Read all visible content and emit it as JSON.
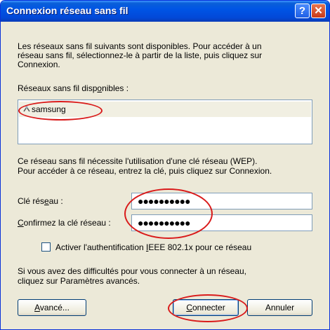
{
  "window": {
    "title": "Connexion réseau sans fil",
    "help_glyph": "?",
    "close_glyph": "✕"
  },
  "intro": {
    "line1": "Les réseaux sans fil suivants sont disponibles. Pour accéder à un",
    "line2": "réseau sans fil, sélectionnez-le à partir de la liste, puis cliquez sur",
    "line3": "Connexion.",
    "networks_label_pre": "Réseaux sans fil disp",
    "networks_label_mn": "o",
    "networks_label_post": "nibles :"
  },
  "networks": [
    {
      "name": "samsung",
      "icon": "wireless-antenna-icon"
    }
  ],
  "wep": {
    "line1": "Ce réseau sans fil nécessite l'utilisation d'une clé réseau (WEP).",
    "line2": "Pour accéder à ce réseau, entrez la clé, puis cliquez sur Connexion."
  },
  "key_field": {
    "label_pre": "Clé rés",
    "label_mn": "e",
    "label_post": "au :",
    "value": "●●●●●●●●●●"
  },
  "confirm_field": {
    "label_mn": "C",
    "label_post": "onfirmez la clé réseau :",
    "value": "●●●●●●●●●●"
  },
  "ieee": {
    "label_pre": "Activer l'authentification ",
    "label_mn": "I",
    "label_post": "EEE 802.1x pour ce réseau",
    "checked": false
  },
  "help": {
    "line1": "Si vous avez des difficultés pour vous connecter à un réseau,",
    "line2": "cliquez sur Paramètres avancés."
  },
  "buttons": {
    "advanced_mn": "A",
    "advanced_post": "vancé...",
    "connect_mn": "C",
    "connect_post": "onnecter",
    "cancel": "Annuler"
  },
  "colors": {
    "titlebar": "#0055e5",
    "dialog_bg": "#ece9d8",
    "highlight_circle": "#d91a1a"
  }
}
